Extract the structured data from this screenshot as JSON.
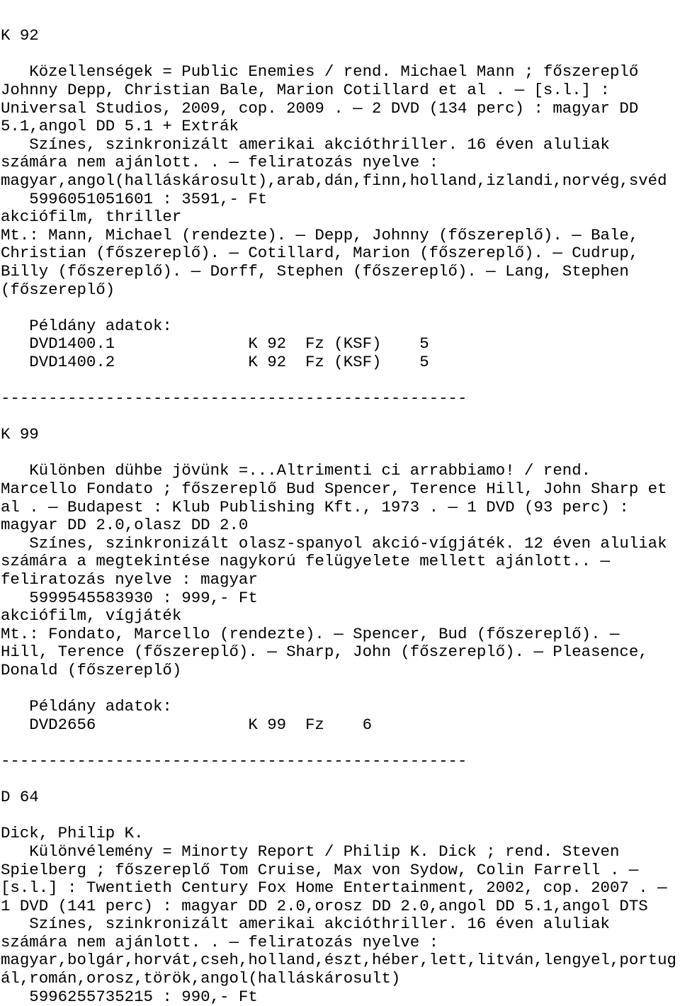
{
  "lines": [
    "-------------------------------------------------",
    "",
    "K 92",
    "",
    "   Közellenségek = Public Enemies / rend. Michael Mann ; főszereplő",
    "Johnny Depp, Christian Bale, Marion Cotillard et al . — [s.l.] :",
    "Universal Studios, 2009, cop. 2009 . — 2 DVD (134 perc) : magyar DD",
    "5.1,angol DD 5.1 + Extrák",
    "   Színes, szinkronizált amerikai akcióthriller. 16 éven aluliak",
    "számára nem ajánlott. . — feliratozás nyelve :",
    "magyar,angol(halláskárosult),arab,dán,finn,holland,izlandi,norvég,svéd",
    "   5996051051601 : 3591,- Ft",
    "akciófilm, thriller",
    "Mt.: Mann, Michael (rendezte). — Depp, Johnny (főszereplő). — Bale,",
    "Christian (főszereplő). — Cotillard, Marion (főszereplő). — Cudrup,",
    "Billy (főszereplő). — Dorff, Stephen (főszereplő). — Lang, Stephen",
    "(főszereplő)",
    "",
    "   Példány adatok:",
    "   DVD1400.1              K 92  Fz (KSF)    5",
    "   DVD1400.2              K 92  Fz (KSF)    5",
    "",
    "-------------------------------------------------",
    "",
    "K 99",
    "",
    "   Különben dühbe jövünk =...Altrimenti ci arrabbiamo! / rend.",
    "Marcello Fondato ; főszereplő Bud Spencer, Terence Hill, John Sharp et",
    "al . — Budapest : Klub Publishing Kft., 1973 . — 1 DVD (93 perc) :",
    "magyar DD 2.0,olasz DD 2.0",
    "   Színes, szinkronizált olasz-spanyol akció-vígjáték. 12 éven aluliak",
    "számára a megtekintése nagykorú felügyelete mellett ajánlott.. —",
    "feliratozás nyelve : magyar",
    "   5999545583930 : 999,- Ft",
    "akciófilm, vígjáték",
    "Mt.: Fondato, Marcello (rendezte). — Spencer, Bud (főszereplő). —",
    "Hill, Terence (főszereplő). — Sharp, John (főszereplő). — Pleasence,",
    "Donald (főszereplő)",
    "",
    "   Példány adatok:",
    "   DVD2656                K 99  Fz    6",
    "",
    "-------------------------------------------------",
    "",
    "D 64",
    "",
    "Dick, Philip K.",
    "   Különvélemény = Minorty Report / Philip K. Dick ; rend. Steven",
    "Spielberg ; főszereplő Tom Cruise, Max von Sydow, Colin Farrell . —",
    "[s.l.] : Twentieth Century Fox Home Entertainment, 2002, cop. 2007 . —",
    "1 DVD (141 perc) : magyar DD 2.0,orosz DD 2.0,angol DD 5.1,angol DTS",
    "   Színes, szinkronizált amerikai akcióthriller. 16 éven aluliak",
    "számára nem ajánlott. . — feliratozás nyelve :",
    "magyar,bolgár,horvát,cseh,holland,észt,héber,lett,litván,lengyel,portug",
    "ál,román,orosz,török,angol(halláskárosult)",
    "   5996255735215 : 990,- Ft"
  ]
}
